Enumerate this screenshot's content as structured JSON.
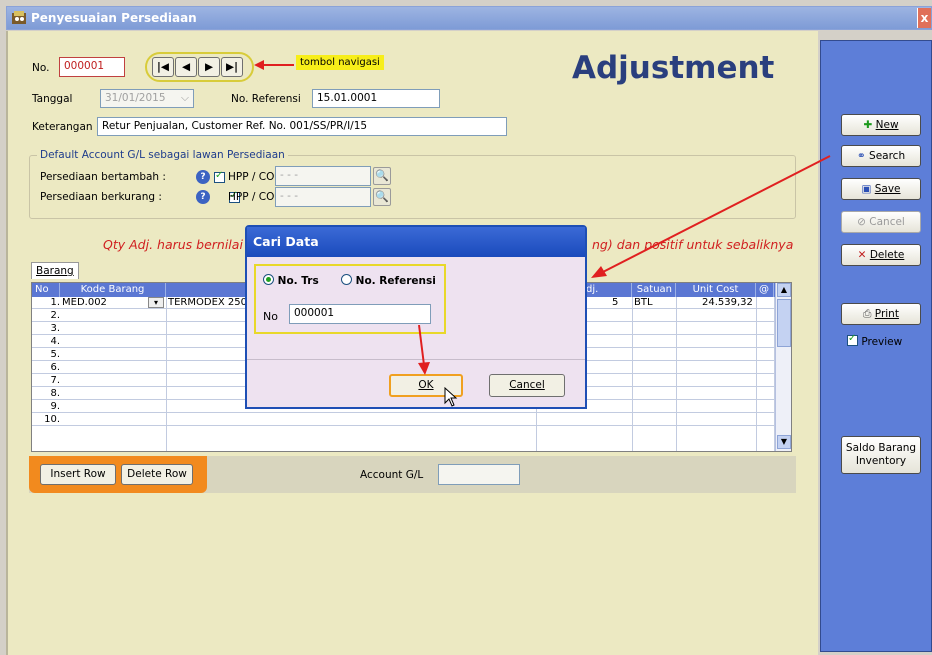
{
  "window": {
    "title": "Penyesuaian Persediaan",
    "close": "x"
  },
  "header": {
    "no_label": "No.",
    "no_value": "000001",
    "nav_annotation": "tombol navigasi",
    "headline": "Adjustment",
    "tanggal_label": "Tanggal",
    "tanggal_value": "31/01/2015",
    "noref_label": "No. Referensi",
    "noref_value": "15.01.0001",
    "keterangan_label": "Keterangan",
    "keterangan_value": "Retur Penjualan, Customer Ref. No. 001/SS/PR/I/15"
  },
  "default_account": {
    "title": "Default Account G/L sebagai lawan Persediaan",
    "bertambah_label": "Persediaan bertambah :",
    "berkurang_label": "Persediaan berkurang :",
    "hpp_label": "HPP / COGS",
    "placeholder": "- - -"
  },
  "warning": {
    "left": "Qty Adj. harus bernilai n",
    "right": "ng) dan positif untuk sebaliknya"
  },
  "grid": {
    "tab": "Barang",
    "columns": [
      "No",
      "Kode Barang",
      "dj.",
      "Satuan",
      "Unit Cost",
      "@"
    ],
    "rows": [
      {
        "no": "1.",
        "kode": "MED.002",
        "nama": "TERMODEX 250",
        "qty": "5",
        "satuan": "BTL",
        "cost": "24.539,32"
      },
      {
        "no": "2."
      },
      {
        "no": "3."
      },
      {
        "no": "4."
      },
      {
        "no": "5."
      },
      {
        "no": "6."
      },
      {
        "no": "7."
      },
      {
        "no": "8."
      },
      {
        "no": "9."
      },
      {
        "no": "10."
      }
    ]
  },
  "bottom": {
    "insert_row": "Insert Row",
    "delete_row": "Delete Row",
    "account_gl": "Account G/L"
  },
  "sidebar": {
    "new": "New",
    "search": "Search",
    "save": "Save",
    "cancel": "Cancel",
    "delete": "Delete",
    "print": "Print",
    "preview": "Preview",
    "saldo_line1": "Saldo Barang",
    "saldo_line2": "Inventory"
  },
  "dialog": {
    "title": "Cari Data",
    "opt_trs": "No. Trs",
    "opt_ref": "No. Referensi",
    "no_label": "No",
    "no_value": "000001",
    "ok": "OK",
    "cancel": "Cancel"
  },
  "colors": {
    "title_blue": "#2a3f7e",
    "sidebar": "#5d7ed8",
    "annotation_red": "#e02020",
    "highlight_yellow": "#e8d82a"
  }
}
